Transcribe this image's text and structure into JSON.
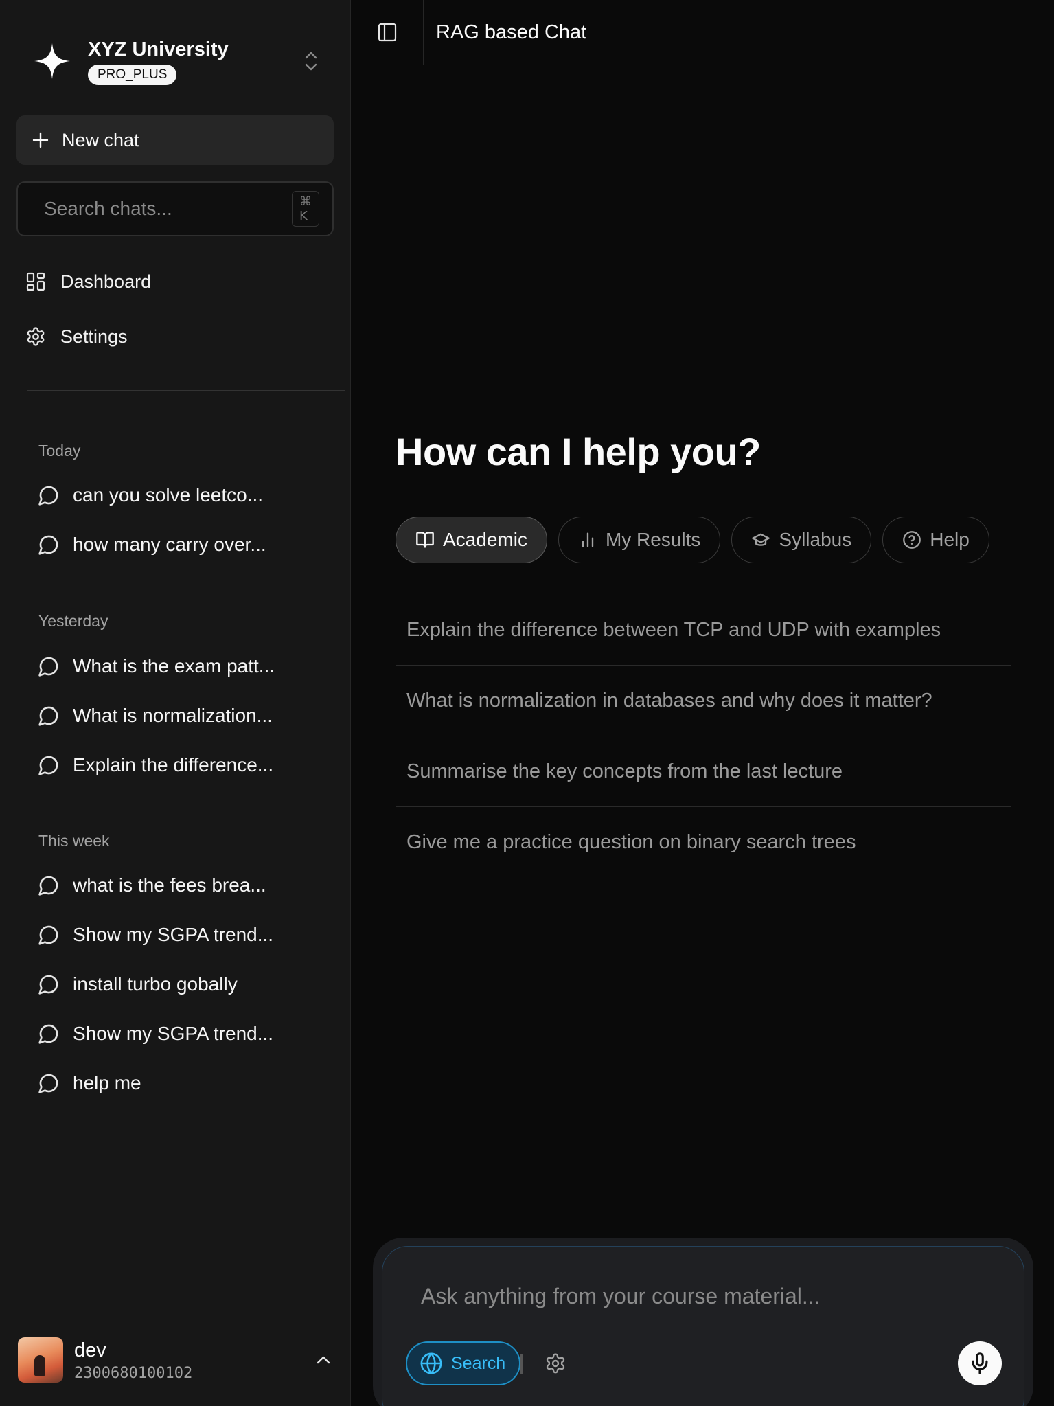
{
  "org": {
    "name": "XYZ University",
    "plan": "PRO_PLUS"
  },
  "sidebar": {
    "new_chat_label": "New chat",
    "search_placeholder": "Search chats...",
    "search_shortcut": "⌘ K",
    "nav": [
      {
        "label": "Dashboard",
        "icon": "dashboard-icon"
      },
      {
        "label": "Settings",
        "icon": "gear-icon"
      }
    ],
    "groups": [
      {
        "label": "Today",
        "items": [
          "can you solve leetco...",
          "how many carry over..."
        ]
      },
      {
        "label": "Yesterday",
        "items": [
          "What is the exam patt...",
          "What is normalization...",
          "Explain the difference..."
        ]
      },
      {
        "label": "This week",
        "items": [
          "what is the fees brea...",
          "Show my SGPA trend...",
          "install turbo gobally",
          "Show my SGPA trend...",
          "help me"
        ]
      }
    ]
  },
  "user": {
    "name": "dev",
    "id": "2300680100102"
  },
  "header": {
    "title": "RAG based Chat"
  },
  "main": {
    "heading": "How can I help you?",
    "chips": [
      {
        "label": "Academic",
        "icon": "book-icon",
        "active": true
      },
      {
        "label": "My Results",
        "icon": "bar-chart-icon",
        "active": false
      },
      {
        "label": "Syllabus",
        "icon": "graduation-cap-icon",
        "active": false
      },
      {
        "label": "Help",
        "icon": "help-circle-icon",
        "active": false
      }
    ],
    "suggestions": [
      "Explain the difference between TCP and UDP with examples",
      "What is normalization in databases and why does it matter?",
      "Summarise the key concepts from the last lecture",
      "Give me a practice question on binary search trees"
    ]
  },
  "composer": {
    "placeholder": "Ask anything from your course material...",
    "search_label": "Search",
    "accent": "#38bdf8"
  }
}
